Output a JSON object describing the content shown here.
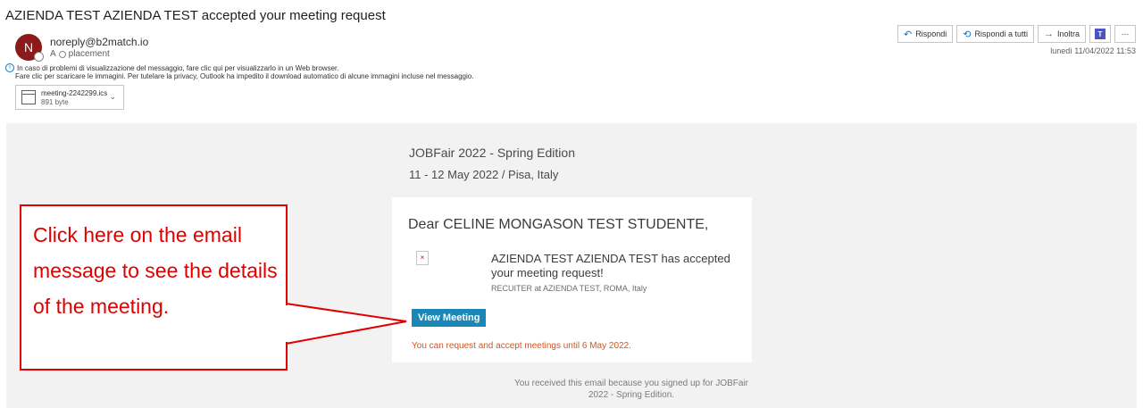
{
  "email": {
    "subject": "AZIENDA TEST AZIENDA TEST accepted your meeting request",
    "avatar_initial": "N",
    "sender": "noreply@b2match.io",
    "to_prefix": "A",
    "to_recipient": "placement",
    "info_line1": "In caso di problemi di visualizzazione del messaggio, fare clic qui per visualizzarlo in un Web browser.",
    "info_line2": "Fare clic per scaricare le immagini. Per tutelare la privacy, Outlook ha impedito il download automatico di alcune immagini incluse nel messaggio.",
    "attachment": {
      "name": "meeting-2242299.ics",
      "size": "891 byte"
    },
    "date": "lunedì 11/04/2022 11:53"
  },
  "toolbar": {
    "reply": "Rispondi",
    "reply_all": "Rispondi a tutti",
    "forward": "Inoltra",
    "more": "···"
  },
  "body": {
    "event_title": "JOBFair 2022 - Spring Edition",
    "event_date": "11 - 12 May 2022 / Pisa, Italy",
    "greeting": "Dear CELINE MONGASON TEST STUDENTE,",
    "accept_message": "AZIENDA TEST AZIENDA TEST has accepted your meeting request!",
    "recruiter_info": "RECUITER at AZIENDA TEST, ROMA, Italy",
    "view_button": "View Meeting",
    "deadline": "You can request and accept meetings until 6 May 2022.",
    "footer": "You received this email because you signed up for JOBFair 2022 - Spring Edition."
  },
  "annotation": {
    "text": "Click here on the email message to see the details of the meeting.",
    "color": "#e00000"
  }
}
